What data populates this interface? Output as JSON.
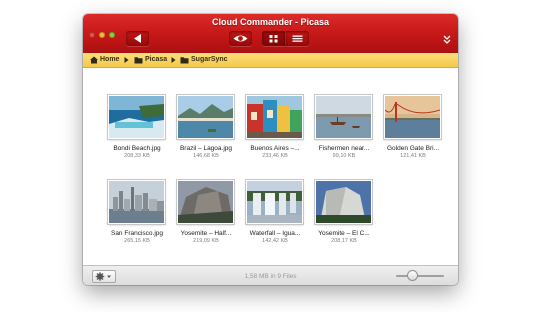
{
  "window": {
    "title": "Cloud Commander - Picasa"
  },
  "path": {
    "items": [
      "Home",
      "Picasa",
      "SugarSync"
    ]
  },
  "files": [
    {
      "name": "Bondi Beach.jpg",
      "size": "208,33 KB"
    },
    {
      "name": "Brazil – Lagoa.jpg",
      "size": "146,68 KB"
    },
    {
      "name": "Buenos Aires –...",
      "size": "233,46 KB"
    },
    {
      "name": "Fishermen near...",
      "size": "99,10 KB"
    },
    {
      "name": "Golden Gate Bri...",
      "size": "121,41 KB"
    },
    {
      "name": "San Francisco.jpg",
      "size": "265,15 KB"
    },
    {
      "name": "Yosemite – Half...",
      "size": "219,09 KB"
    },
    {
      "name": "Waterfall – Igua...",
      "size": "142,42 KB"
    },
    {
      "name": "Yosemite – El C...",
      "size": "208,17 KB"
    }
  ],
  "status": {
    "summary": "1,58 MB in 9 Files"
  },
  "zoom": {
    "level": 0.3
  },
  "icons": {
    "back": "back-arrow-icon",
    "eye": "eye-icon",
    "grid": "grid-view-icon",
    "list": "list-view-icon",
    "collapse": "double-chevron-down-icon",
    "home": "home-icon",
    "folder": "folder-icon",
    "gear": "gear-icon"
  },
  "colors": {
    "titlebar": "#c41717",
    "pathbar": "#f4c84a"
  }
}
